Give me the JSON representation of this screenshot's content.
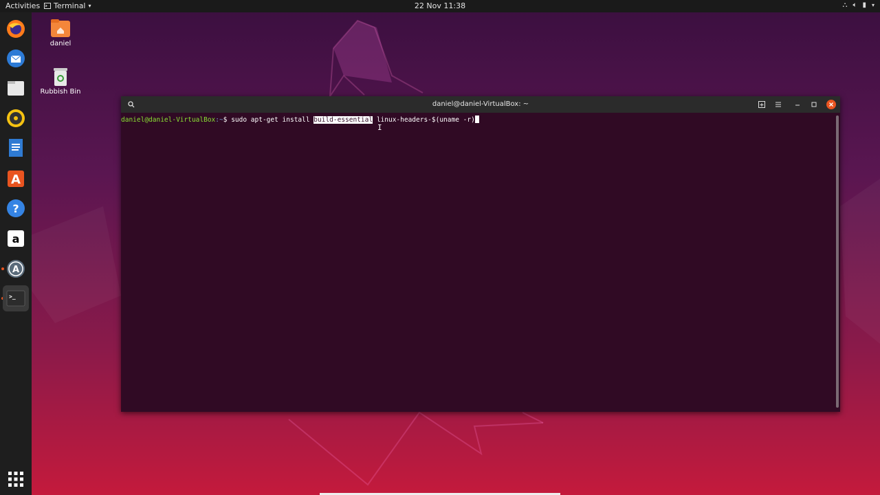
{
  "topbar": {
    "activities": "Activities",
    "app_menu": "Terminal",
    "clock": "22 Nov  11:38"
  },
  "desktop": {
    "home_label": "daniel",
    "trash_label": "Rubbish Bin"
  },
  "dock": {
    "items": [
      "firefox",
      "thunderbird",
      "files",
      "rhythmbox",
      "libreoffice-writer",
      "software-center",
      "help",
      "amazon",
      "software-updater",
      "terminal",
      "show-applications"
    ]
  },
  "terminal": {
    "title": "daniel@daniel-VirtualBox: ~",
    "prompt_user": "daniel@daniel-VirtualBox",
    "prompt_path": ":~",
    "prompt_symbol": "$ ",
    "command_before": "sudo apt-get install ",
    "command_selected": "build-essential",
    "command_after": " linux-headers-$(uname -r)"
  },
  "colors": {
    "terminal_bg": "#300a24",
    "prompt_user": "#8ae234",
    "prompt_path": "#729fcf",
    "accent": "#e95420"
  }
}
